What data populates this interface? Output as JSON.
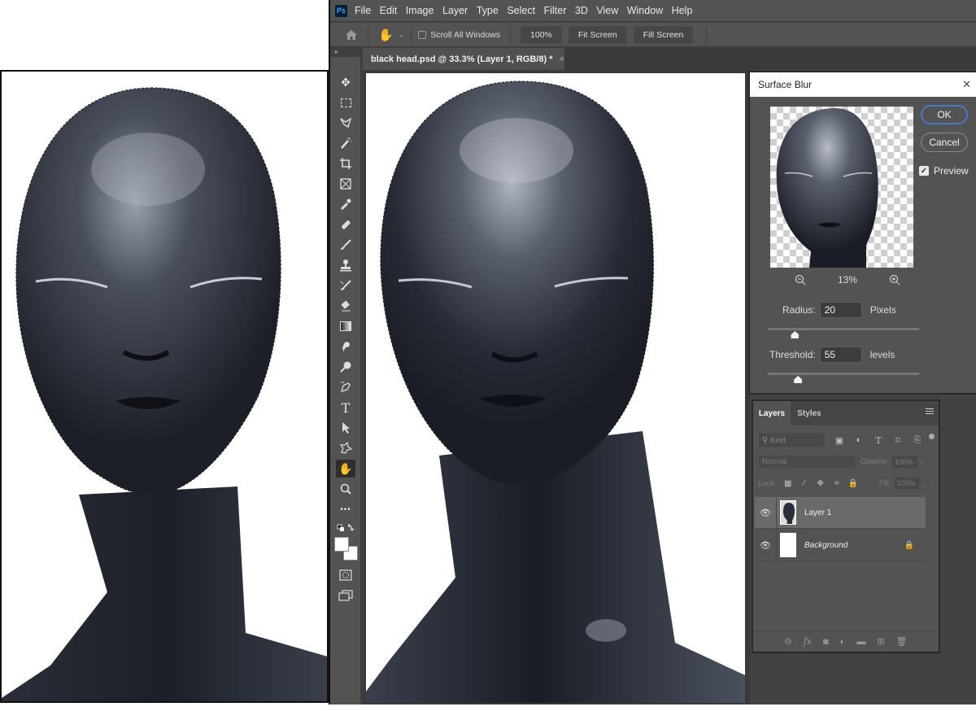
{
  "menubar": {
    "app_icon": "Ps",
    "items": [
      "File",
      "Edit",
      "Image",
      "Layer",
      "Type",
      "Select",
      "Filter",
      "3D",
      "View",
      "Window",
      "Help"
    ]
  },
  "options_bar": {
    "home_icon": "home-icon",
    "tool_icon": "hand-icon",
    "scroll_all_windows": {
      "label": "Scroll All Windows",
      "checked": false
    },
    "zoom_100_label": "100%",
    "fit_screen_label": "Fit Screen",
    "fill_screen_label": "Fill Screen"
  },
  "document_tab": {
    "title": "black head.psd @ 33.3% (Layer 1, RGB/8) *",
    "close_glyph": "×"
  },
  "toolbar": {
    "collapse_glyph": "»",
    "tools": [
      {
        "name": "move-tool",
        "glyph": "✥"
      },
      {
        "name": "marquee-tool",
        "glyph": "⬚"
      },
      {
        "name": "lasso-tool",
        "glyph": "ᛉ"
      },
      {
        "name": "magic-wand-tool",
        "glyph": "⁄"
      },
      {
        "name": "crop-tool",
        "glyph": "⌗"
      },
      {
        "name": "frame-tool",
        "glyph": "⊠"
      },
      {
        "name": "eyedropper-tool",
        "glyph": "⌿"
      },
      {
        "name": "healing-brush-tool",
        "glyph": "✚"
      },
      {
        "name": "brush-tool",
        "glyph": "⁄"
      },
      {
        "name": "clone-stamp-tool",
        "glyph": "⊥"
      },
      {
        "name": "history-brush-tool",
        "glyph": "↯"
      },
      {
        "name": "eraser-tool",
        "glyph": "⌫"
      },
      {
        "name": "gradient-tool",
        "glyph": "▭"
      },
      {
        "name": "blur-tool",
        "glyph": "✋"
      },
      {
        "name": "dodge-tool",
        "glyph": "⚲"
      },
      {
        "name": "pen-tool",
        "glyph": "✒"
      },
      {
        "name": "type-tool",
        "glyph": "T"
      },
      {
        "name": "path-selection-tool",
        "glyph": "➤"
      },
      {
        "name": "custom-shape-tool",
        "glyph": "✱"
      },
      {
        "name": "hand-tool",
        "glyph": "✋"
      },
      {
        "name": "zoom-tool",
        "glyph": "🔍"
      },
      {
        "name": "more-tools",
        "glyph": "•••"
      }
    ],
    "bottom": [
      {
        "name": "quick-mask-tool",
        "glyph": "◌"
      },
      {
        "name": "screen-mode-tool",
        "glyph": "⧉"
      }
    ]
  },
  "surface_blur_dialog": {
    "title": "Surface Blur",
    "ok_label": "OK",
    "cancel_label": "Cancel",
    "preview_label": "Preview",
    "preview_checked": true,
    "zoom_level": "13%",
    "radius": {
      "label": "Radius:",
      "value": "20",
      "unit": "Pixels",
      "slider_fraction": 0.18
    },
    "threshold": {
      "label": "Threshold:",
      "value": "55",
      "unit": "levels",
      "slider_fraction": 0.2
    }
  },
  "layers_panel": {
    "tabs": [
      {
        "label": "Layers",
        "active": true
      },
      {
        "label": "Styles",
        "active": false
      }
    ],
    "kind_filter": "Kind",
    "blend_mode": "Normal",
    "opacity_label": "Opacity:",
    "opacity_value": "100%",
    "lock_label": "Lock:",
    "fill_label": "Fill:",
    "fill_value": "100%",
    "layers": [
      {
        "name": "Layer 1",
        "selected": true,
        "visible": true,
        "locked": false,
        "italic": false
      },
      {
        "name": "Background",
        "selected": false,
        "visible": true,
        "locked": true,
        "italic": true
      }
    ],
    "footer_icons": [
      "link-icon",
      "fx-icon",
      "mask-icon",
      "adjustment-icon",
      "folder-icon",
      "new-layer-icon",
      "trash-icon"
    ]
  },
  "colors": {
    "ui_panel": "#535353",
    "ui_dark": "#424242",
    "ok_border": "#4a76c9"
  }
}
